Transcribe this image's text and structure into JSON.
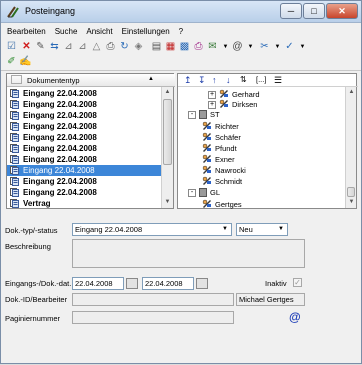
{
  "window": {
    "title": "Posteingang",
    "minimize_glyph": "─",
    "maximize_glyph": "□",
    "close_glyph": "✕"
  },
  "menu": {
    "items": [
      "Bearbeiten",
      "Suche",
      "Ansicht",
      "Einstellungen",
      "?"
    ]
  },
  "list": {
    "column_header": "Dokumententyp",
    "sort_glyph": "▲",
    "rows": [
      {
        "label": "Eingang 22.04.2008",
        "selected": false
      },
      {
        "label": "Eingang 22.04.2008",
        "selected": false
      },
      {
        "label": "Eingang 22.04.2008",
        "selected": false
      },
      {
        "label": "Eingang 22.04.2008",
        "selected": false
      },
      {
        "label": "Eingang 22.04.2008",
        "selected": false
      },
      {
        "label": "Eingang 22.04.2008",
        "selected": false
      },
      {
        "label": "Eingang 22.04.2008",
        "selected": false
      },
      {
        "label": "Eingang 22.04.2008",
        "selected": true
      },
      {
        "label": "Eingang 22.04.2008",
        "selected": false
      },
      {
        "label": "Eingang 22.04.2008",
        "selected": false
      },
      {
        "label": "Vertrag",
        "selected": false
      }
    ]
  },
  "tree": {
    "toolbar_text": "[...]",
    "nodes": [
      {
        "label": "Gerhard",
        "kind": "person",
        "expander": "+"
      },
      {
        "label": "Dirksen",
        "kind": "person",
        "expander": "+"
      },
      {
        "label": "ST",
        "kind": "folder",
        "expander": "-"
      },
      {
        "label": "Richter",
        "kind": "person",
        "expander": ""
      },
      {
        "label": "Schäfer",
        "kind": "person",
        "expander": ""
      },
      {
        "label": "Pfundt",
        "kind": "person",
        "expander": ""
      },
      {
        "label": "Exner",
        "kind": "person",
        "expander": ""
      },
      {
        "label": "Nawrocki",
        "kind": "person",
        "expander": ""
      },
      {
        "label": "Schmidt",
        "kind": "person",
        "expander": ""
      },
      {
        "label": "GL",
        "kind": "folder",
        "expander": "-"
      },
      {
        "label": "Gertges",
        "kind": "person",
        "expander": ""
      }
    ]
  },
  "form": {
    "doc_type_label": "Dok.-typ/-status",
    "doc_type_value": "Eingang 22.04.2008",
    "status_value": "Neu",
    "description_label": "Beschreibung",
    "dates_label": "Eingangs-/Dok.-dat.",
    "date_in": "22.04.2008",
    "date_doc": "22.04.2008",
    "inactive_label": "Inaktiv",
    "inactive_glyph": "✓",
    "doc_id_label": "Dok.-ID/Bearbeiter",
    "editor_value": "Michael Gertges",
    "page_number_label": "Paginiernummer",
    "at_glyph": "@"
  },
  "colors": {
    "selection": "#3c86d8",
    "window_border": "#7a8ea8"
  }
}
